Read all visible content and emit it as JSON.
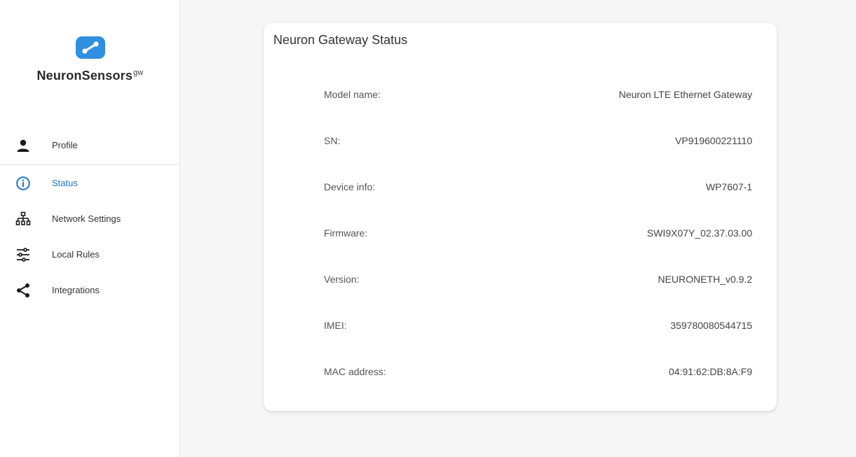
{
  "brand": {
    "name": "NeuronSensors",
    "suffix": "gw"
  },
  "nav": [
    {
      "label": "Profile",
      "icon": "person-icon"
    },
    {
      "label": "Status",
      "icon": "info-icon",
      "active": true
    },
    {
      "label": "Network Settings",
      "icon": "network-icon"
    },
    {
      "label": "Local Rules",
      "icon": "sliders-icon"
    },
    {
      "label": "Integrations",
      "icon": "share-icon"
    }
  ],
  "card": {
    "title": "Neuron Gateway Status",
    "rows": [
      {
        "label": "Model name:",
        "value": "Neuron LTE Ethernet Gateway"
      },
      {
        "label": "SN:",
        "value": "VP919600221110"
      },
      {
        "label": "Device info:",
        "value": "WP7607-1"
      },
      {
        "label": "Firmware:",
        "value": "SWI9X07Y_02.37.03.00"
      },
      {
        "label": "Version:",
        "value": "NEURONETH_v0.9.2"
      },
      {
        "label": "IMEI:",
        "value": "359780080544715"
      },
      {
        "label": "MAC address:",
        "value": "04:91:62:DB:8A:F9"
      }
    ]
  },
  "colors": {
    "accent": "#1d74c9",
    "logo": "#2f8fe0"
  }
}
